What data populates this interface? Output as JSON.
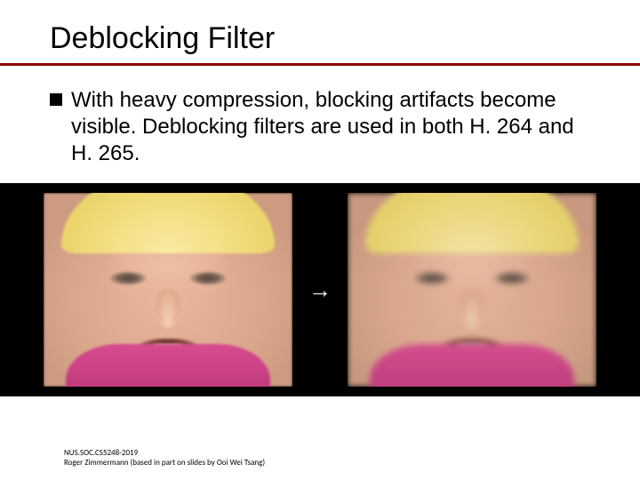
{
  "title": "Deblocking Filter",
  "bullet": "With heavy compression, blocking artifacts become visible. Deblocking filters are used in both H. 264 and H. 265.",
  "arrow_glyph": "→",
  "footer": {
    "line1": "NUS.SOC.CS5248-2019",
    "line2": "Roger Zimmermann (based in part on slides by Ooi Wei Tsang)"
  }
}
